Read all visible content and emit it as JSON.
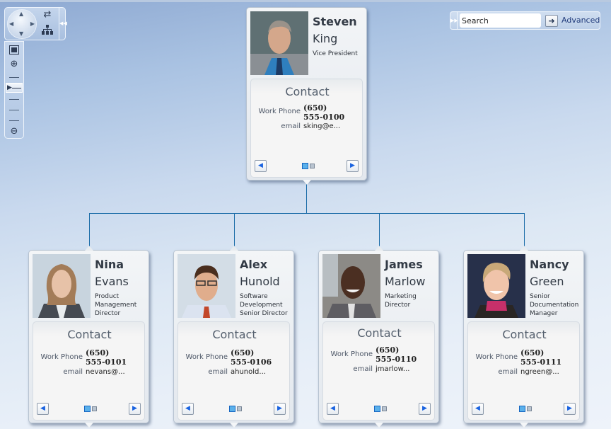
{
  "controls": {
    "pan_icon": "pan-dpad-icon",
    "swap_icon": "swap-icon",
    "layout_icon": "hierarchy-icon",
    "fit_icon": "zoom-to-fit-icon",
    "zoom_in_icon": "zoom-in-icon",
    "zoom_out_icon": "zoom-out-icon",
    "collapse_icon": "collapse-icon",
    "zoom_level": 0.5
  },
  "search": {
    "placeholder": "Search",
    "value": "Search",
    "go_icon": "arrow-right-icon",
    "advanced_label": "Advanced"
  },
  "colors": {
    "connector": "#1b6ca8",
    "active_dot": "#5ab0ea",
    "link": "#1f3a7a"
  },
  "contact_label": "Contact",
  "work_phone_label": "Work Phone",
  "email_label": "email",
  "root": {
    "first": "Steven",
    "last": "King",
    "title": "Vice President",
    "phone_area": "(650)",
    "phone_num": "555-0100",
    "email": "sking@e..."
  },
  "reports": [
    {
      "first": "Nina",
      "last": "Evans",
      "title": "Product Management Director",
      "phone_area": "(650)",
      "phone_num": "555-0101",
      "email": "nevans@..."
    },
    {
      "first": "Alex",
      "last": "Hunold",
      "title": "Software Development Senior Director",
      "phone_area": "(650)",
      "phone_num": "555-0106",
      "email": "ahunold..."
    },
    {
      "first": "James",
      "last": "Marlow",
      "title": "Marketing Director",
      "phone_area": "(650)",
      "phone_num": "555-0110",
      "email": "jmarlow..."
    },
    {
      "first": "Nancy",
      "last": "Green",
      "title": "Senior Documentation Manager",
      "phone_area": "(650)",
      "phone_num": "555-0111",
      "email": "ngreen@..."
    }
  ]
}
